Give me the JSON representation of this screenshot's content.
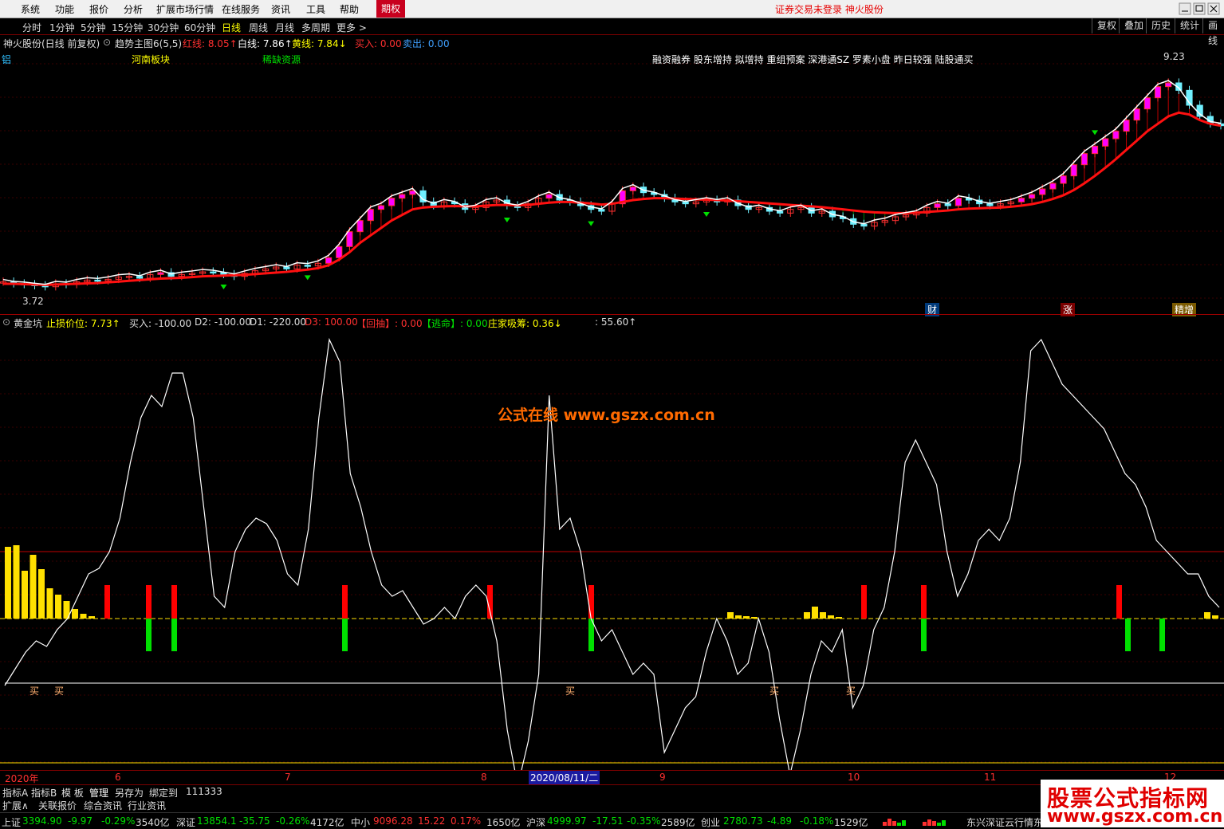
{
  "menu": {
    "items": [
      "系统",
      "功能",
      "报价",
      "分析",
      "扩展市场行情",
      "在线服务",
      "资讯",
      "工具",
      "帮助"
    ],
    "futures": "期权",
    "login_status": "证券交易未登录  神火股份"
  },
  "toolbar": {
    "periods": [
      "分时",
      "1分钟",
      "5分钟",
      "15分钟",
      "30分钟",
      "60分钟",
      "日线",
      "周线",
      "月线",
      "多周期",
      "更多 >"
    ],
    "active_period": "日线",
    "right_buttons": [
      "复权",
      "叠加",
      "历史",
      "统计",
      "画线"
    ]
  },
  "main_header": {
    "stock": "神火股份(日线 前复权)",
    "indicator": "趋势主图6(5,5)",
    "red_line": "红线: 8.05↑",
    "white_line": "白线: 7.86↑",
    "yellow_line": "黄线: 7.84↓",
    "buy": "买入: 0.00",
    "sell": "卖出: 0.00"
  },
  "concepts": {
    "left": "铝",
    "region": "河南板块",
    "resource": "稀缺资源",
    "tags": "融资融券 股东增持 拟增持 重组预案 深港通SZ 罗素小盘 昨日较强 陆股通买"
  },
  "price_marks": {
    "high": "9.23",
    "low": "3.72",
    "event_cai": "财",
    "event_zhang": "涨",
    "event_zeng": "精增"
  },
  "sub_header": {
    "name": "黄金坑",
    "stop": "止损价位: 7.73↑",
    "buy": "买入: -100.00",
    "d2": "D2: -100.00",
    "d1": "D1: -220.00",
    "d3": "D3: 100.00",
    "huichou": "【回抽】: 0.00",
    "taoming": "【逃命】: 0.00",
    "zhuangjia": "庄家吸筹: 0.36↓",
    "extra": ": 55.60↑"
  },
  "buy_labels": [
    "买",
    "买",
    "买",
    "买",
    "买"
  ],
  "watermark": "公式在线  www.gszx.com.cn",
  "date_axis": {
    "labels": [
      "2020年",
      "6",
      "7",
      "8",
      "9",
      "10",
      "11",
      "12"
    ],
    "cursor": "2020/08/11/二"
  },
  "tabs1": [
    "指标A",
    "指标B",
    "模 板",
    "管理",
    "另存为",
    "绑定到",
    "111333"
  ],
  "tabs2": [
    "扩展∧",
    "关联报价",
    "综合资讯",
    "行业资讯"
  ],
  "status": [
    {
      "name": "上证",
      "price": "3394.90",
      "chg": "-9.97",
      "pct": "-0.29%",
      "vol": "3540亿"
    },
    {
      "name": "深证",
      "price": "13854.1",
      "chg": "-35.75",
      "pct": "-0.26%",
      "vol": "4172亿"
    },
    {
      "name": "中小",
      "price": "9096.28",
      "chg": "15.22",
      "pct": "0.17%",
      "vol": "1650亿"
    },
    {
      "name": "沪深",
      "price": "4999.97",
      "chg": "-17.51",
      "pct": "-0.35%",
      "vol": "2589亿"
    },
    {
      "name": "创业",
      "price": "2780.73",
      "chg": "-4.89",
      "pct": "-0.18%",
      "vol": "1529亿"
    }
  ],
  "status_right": "东兴深证云行情东兴",
  "logo": {
    "line1": "股票公式指标网",
    "line2": "www.gszx.com.cn"
  },
  "colors": {
    "up": "#ff3030",
    "down": "#00e000",
    "menu_accent": "#c8001e",
    "yellow": "#ffe000",
    "magenta": "#ff00ff",
    "cyan": "#70f0ff"
  },
  "chart_data": {
    "type": "line",
    "series": [
      {
        "values": [
          3.85,
          3.8,
          3.78,
          3.75,
          3.72,
          3.8,
          3.78,
          3.85,
          3.9,
          3.88,
          3.92,
          3.98,
          4.0,
          3.95,
          4.05,
          4.1,
          4.0,
          4.05,
          4.08,
          4.12,
          4.1,
          4.05,
          4.0,
          4.08,
          4.15,
          4.2,
          4.25,
          4.2,
          4.3,
          4.28,
          4.35,
          4.5,
          4.8,
          5.2,
          5.5,
          5.8,
          5.9,
          6.1,
          6.2,
          6.3,
          6.0,
          5.9,
          6.0,
          5.95,
          5.8,
          5.85,
          6.0,
          6.05,
          5.9,
          5.85,
          5.95,
          6.1,
          6.2,
          6.05,
          6.0,
          5.9,
          5.8,
          5.75,
          5.95,
          6.3,
          6.4,
          6.25,
          6.2,
          6.1,
          6.0,
          5.95,
          6.0,
          6.05,
          6.0,
          6.05,
          5.9,
          5.8,
          5.85,
          5.75,
          5.7,
          5.8,
          5.85,
          5.7,
          5.75,
          5.6,
          5.55,
          5.4,
          5.35,
          5.45,
          5.5,
          5.6,
          5.65,
          5.7,
          5.85,
          5.95,
          5.9,
          6.1,
          6.05,
          5.95,
          5.9,
          5.95,
          6.0,
          6.1,
          6.2,
          6.35,
          6.5,
          6.7,
          7.0,
          7.3,
          7.5,
          7.7,
          7.9,
          8.2,
          8.5,
          8.8,
          9.1,
          9.2,
          9.0,
          8.6,
          8.3,
          8.1,
          8.05
        ]
      },
      {
        "values": [
          3.8,
          3.8,
          3.79,
          3.78,
          3.77,
          3.78,
          3.79,
          3.8,
          3.81,
          3.82,
          3.84,
          3.86,
          3.88,
          3.9,
          3.92,
          3.94,
          3.95,
          3.96,
          3.98,
          4.0,
          4.01,
          4.02,
          4.03,
          4.04,
          4.06,
          4.08,
          4.1,
          4.12,
          4.15,
          4.18,
          4.22,
          4.3,
          4.45,
          4.65,
          4.9,
          5.1,
          5.3,
          5.5,
          5.65,
          5.8,
          5.85,
          5.87,
          5.88,
          5.89,
          5.88,
          5.88,
          5.9,
          5.92,
          5.92,
          5.91,
          5.92,
          5.95,
          5.98,
          6.0,
          6.0,
          5.98,
          5.96,
          5.93,
          5.95,
          6.0,
          6.05,
          6.08,
          6.1,
          6.1,
          6.09,
          6.08,
          6.07,
          6.06,
          6.05,
          6.04,
          6.02,
          6.0,
          5.98,
          5.96,
          5.94,
          5.92,
          5.9,
          5.88,
          5.86,
          5.83,
          5.8,
          5.77,
          5.74,
          5.72,
          5.71,
          5.7,
          5.7,
          5.71,
          5.73,
          5.75,
          5.77,
          5.8,
          5.82,
          5.83,
          5.84,
          5.85,
          5.87,
          5.9,
          5.94,
          6.0,
          6.08,
          6.18,
          6.32,
          6.5,
          6.7,
          6.92,
          7.15,
          7.4,
          7.65,
          7.9,
          8.1,
          8.3,
          8.4,
          8.35,
          8.2,
          8.1,
          8.05
        ]
      }
    ],
    "oscillator": [
      -60,
      -45,
      -30,
      -20,
      -25,
      -10,
      0,
      20,
      40,
      45,
      60,
      90,
      140,
      180,
      200,
      190,
      220,
      220,
      180,
      100,
      20,
      10,
      60,
      80,
      90,
      85,
      70,
      40,
      30,
      80,
      180,
      250,
      230,
      130,
      100,
      60,
      30,
      20,
      25,
      10,
      -5,
      0,
      10,
      0,
      20,
      30,
      20,
      -20,
      -100,
      -150,
      -110,
      -50,
      200,
      80,
      90,
      60,
      0,
      -20,
      -10,
      -30,
      -50,
      -40,
      -50,
      -120,
      -100,
      -80,
      -70,
      -30,
      0,
      -20,
      -50,
      -40,
      0,
      -30,
      -90,
      -140,
      -100,
      -50,
      -20,
      -30,
      -10,
      -80,
      -60,
      -10,
      10,
      60,
      140,
      160,
      140,
      120,
      60,
      20,
      40,
      70,
      80,
      70,
      90,
      140,
      240,
      250,
      230,
      210,
      200,
      190,
      180,
      170,
      150,
      130,
      120,
      100,
      70,
      60,
      50,
      40,
      40,
      20,
      10
    ]
  }
}
